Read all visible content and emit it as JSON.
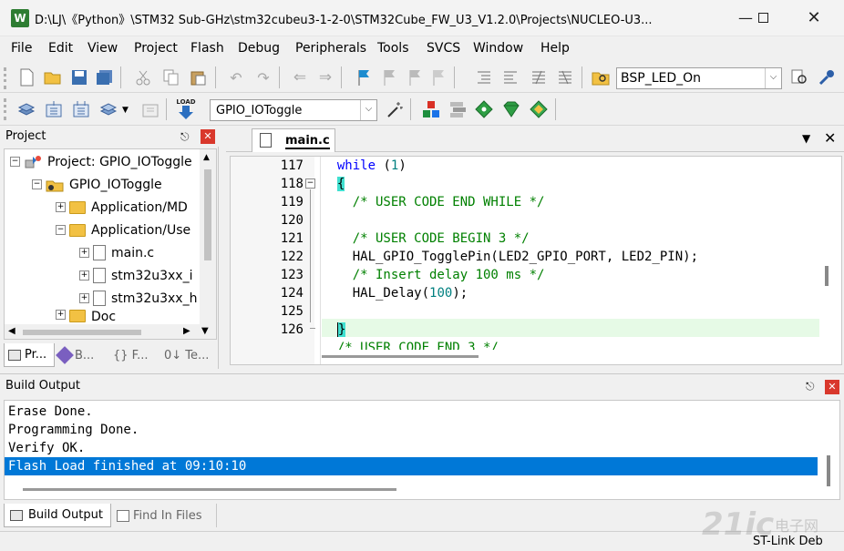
{
  "window": {
    "title": "D:\\LJ\\《Python》\\STM32 Sub-GHz\\stm32cubeu3-1-2-0\\STM32Cube_FW_U3_V1.2.0\\Projects\\NUCLEO-U3...",
    "app_icon_glyph": "W"
  },
  "menu": [
    "File",
    "Edit",
    "View",
    "Project",
    "Flash",
    "Debug",
    "Peripherals",
    "Tools",
    "SVCS",
    "Window",
    "Help"
  ],
  "toolbar1": {
    "find_combo_value": "BSP_LED_On"
  },
  "toolbar2": {
    "load_label": "LOAD",
    "target_combo_value": "GPIO_IOToggle"
  },
  "project_panel": {
    "title": "Project",
    "tree": [
      {
        "level": 0,
        "expander": "⊟",
        "icon": "project",
        "label": "Project: GPIO_IOToggle"
      },
      {
        "level": 1,
        "expander": "⊟",
        "icon": "target",
        "label": "GPIO_IOToggle"
      },
      {
        "level": 2,
        "expander": "⊞",
        "icon": "folder",
        "label": "Application/MD"
      },
      {
        "level": 2,
        "expander": "⊟",
        "icon": "folder",
        "label": "Application/Use"
      },
      {
        "level": 3,
        "expander": "⊞",
        "icon": "file",
        "label": "main.c"
      },
      {
        "level": 3,
        "expander": "⊞",
        "icon": "file",
        "label": "stm32u3xx_i"
      },
      {
        "level": 3,
        "expander": "⊞",
        "icon": "file",
        "label": "stm32u3xx_h"
      },
      {
        "level": 2,
        "expander": "⊞",
        "icon": "folder",
        "label": "Doc"
      }
    ],
    "tabs": [
      "Pr...",
      "B...",
      "{} F...",
      "0↓ Te..."
    ]
  },
  "editor": {
    "tab_label": "main.c",
    "lines": [
      {
        "no": "117",
        "fold": "",
        "text": "  while (1)",
        "kind": "kw"
      },
      {
        "no": "118",
        "fold": "⊟",
        "text": "  {",
        "kind": "brace-hl"
      },
      {
        "no": "119",
        "fold": "",
        "text": "    /* USER CODE END WHILE */",
        "kind": "cm"
      },
      {
        "no": "120",
        "fold": "",
        "text": "",
        "kind": "plain"
      },
      {
        "no": "121",
        "fold": "",
        "text": "    /* USER CODE BEGIN 3 */",
        "kind": "cm"
      },
      {
        "no": "122",
        "fold": "",
        "text": "    HAL_GPIO_TogglePin(LED2_GPIO_PORT, LED2_PIN);",
        "kind": "plain"
      },
      {
        "no": "123",
        "fold": "",
        "text": "    /* Insert delay 100 ms */",
        "kind": "cm"
      },
      {
        "no": "124",
        "fold": "",
        "text": "    HAL_Delay(100);",
        "kind": "delay"
      },
      {
        "no": "125",
        "fold": "",
        "text": "",
        "kind": "plain"
      },
      {
        "no": "126",
        "fold": "-",
        "text": "  }",
        "kind": "brace-cur"
      }
    ],
    "partial_line": "  /* USER CODE END 3 */"
  },
  "build_output": {
    "title": "Build Output",
    "lines": [
      "Erase Done.",
      "Programming Done.",
      "Verify OK.",
      "Flash Load finished at 09:10:10"
    ],
    "tabs": [
      "Build Output",
      "Find In Files"
    ]
  },
  "status": {
    "debugger": "ST-Link Deb"
  },
  "watermark": {
    "text": "21ic",
    "subtext": "电子网"
  },
  "colors": {
    "selection": "#0078d7",
    "current_line": "#e6fae6",
    "comment": "#008000",
    "keyword": "#0000ff"
  }
}
